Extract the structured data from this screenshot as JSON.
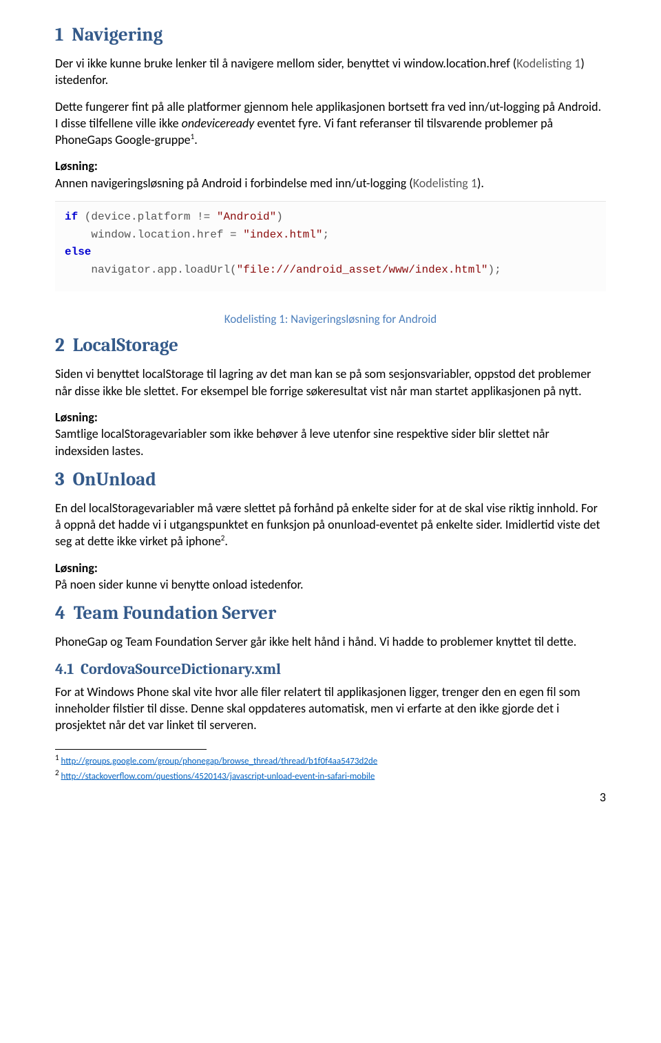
{
  "sections": {
    "s1": {
      "num": "1",
      "title": "Navigering",
      "p1a": "Der vi ikke kunne bruke lenker til å navigere mellom sider, benyttet vi window.location.href (",
      "p1ref": "Kodelisting 1",
      "p1b": ") istedenfor.",
      "p2a": "Dette fungerer fint på alle platformer gjennom hele applikasjonen bortsett fra ved inn/ut-logging på Android. I disse tilfellene ville ikke ",
      "p2i": "ondeviceready",
      "p2b": " eventet fyre. Vi fant referanser til tilsvarende problemer på PhoneGaps Google-gruppe",
      "p2sup": "1",
      "p2c": ".",
      "los": "Løsning:",
      "p3a": "Annen navigeringsløsning på Android i forbindelse med inn/ut-logging (",
      "p3ref": "Kodelisting 1",
      "p3b": ")."
    },
    "code1": {
      "l1a": "if",
      "l1b": " (device.platform != ",
      "l1c": "\"Android\"",
      "l1d": ")",
      "l2a": "    window.location.href = ",
      "l2b": "\"index.html\"",
      "l2c": ";",
      "l3a": "else",
      "l4a": "    navigator.app.loadUrl(",
      "l4b": "\"file:///android_asset/www/index.html\"",
      "l4c": ");"
    },
    "caption1": "Kodelisting 1: Navigeringsløsning for Android",
    "s2": {
      "num": "2",
      "title": "LocalStorage",
      "p1": "Siden vi benyttet localStorage til lagring av det man kan se på som sesjonsvariabler, oppstod det problemer når disse ikke ble slettet. For eksempel ble forrige søkeresultat vist når man startet applikasjonen på nytt.",
      "los": "Løsning:",
      "p2": "Samtlige localStoragevariabler som ikke behøver å leve utenfor sine respektive sider blir slettet når indexsiden lastes."
    },
    "s3": {
      "num": "3",
      "title": "OnUnload",
      "p1a": "En del localStoragevariabler må være slettet på forhånd på enkelte sider for at de skal vise riktig innhold. For å oppnå det hadde vi i utgangspunktet en funksjon på onunload-eventet på enkelte sider. Imidlertid viste det seg at dette ikke virket på iphone",
      "p1sup": "2",
      "p1b": ".",
      "los": "Løsning:",
      "p2": "På noen sider kunne vi benytte onload istedenfor."
    },
    "s4": {
      "num": "4",
      "title": "Team Foundation Server",
      "p1": "PhoneGap og Team Foundation Server går ikke helt hånd i hånd. Vi hadde to problemer knyttet til dette."
    },
    "s41": {
      "num": "4.1",
      "title": "CordovaSourceDictionary.xml",
      "p1": "For at Windows Phone skal vite hvor alle filer relatert til applikasjonen ligger, trenger den en egen fil som inneholder filstier til disse. Denne skal oppdateres automatisk, men vi erfarte at den ikke gjorde det i prosjektet når det var linket til serveren."
    },
    "footnotes": {
      "f1n": "1",
      "f1": "http://groups.google.com/group/phonegap/browse_thread/thread/b1f0f4aa5473d2de",
      "f2n": "2",
      "f2": "http://stackoverflow.com/questions/4520143/javascript-unload-event-in-safari-mobile"
    },
    "page_num": "3"
  }
}
